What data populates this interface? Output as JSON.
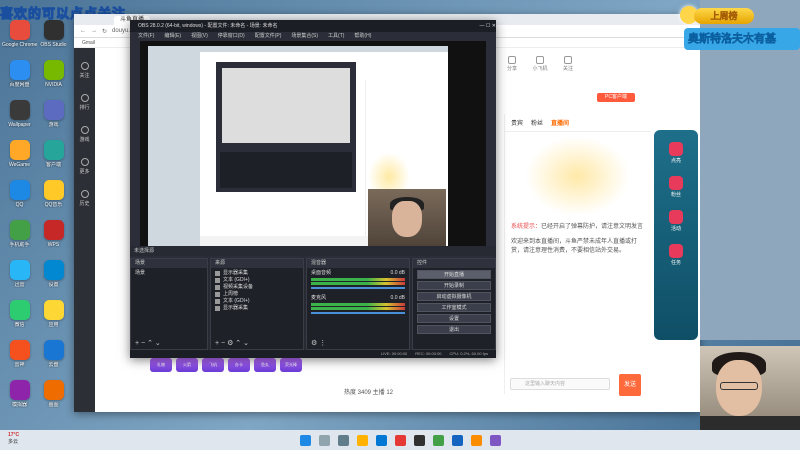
{
  "overlay": {
    "left_banner": "喜欢的可以点点关注",
    "right_badge": "上周榜",
    "right_scroll": "奥斯特洛夫木有基"
  },
  "desktop_icons": {
    "col1": [
      "Google Chrome",
      "百度网盘",
      "Wallpaper",
      "WeGame",
      "QQ",
      "手机助手",
      "迅雷",
      "微信",
      "雷神",
      "模拟器"
    ],
    "col2": [
      "OBS Studio",
      "NVIDIA",
      "游戏",
      "客户端",
      "QQ音乐",
      "WPS",
      "设置",
      "应用",
      "云盘",
      "画图"
    ]
  },
  "browser": {
    "tab_label": "斗鱼直播",
    "address": "douyu.com",
    "bookmark": "Gmail",
    "left_nav": [
      "关注",
      "排行",
      "游戏",
      "更多",
      "历史"
    ],
    "top_actions": [
      "分享",
      "小飞机",
      "关注"
    ],
    "pc_button": "PC客户端",
    "chat_tabs": [
      "贵宾",
      "粉丝",
      "直播间"
    ],
    "chat_messages": [
      {
        "prefix": "系统提示：",
        "text": "已经开启了弹幕防护，请注意文明发言"
      },
      {
        "prefix": "",
        "text": "欢迎来到本直播间，斗鱼严禁未成年人直播或打赏，请注意理性消费，不要相信站外交易。"
      }
    ],
    "right_rail": [
      "点亮",
      "粉丝",
      "活动",
      "任务"
    ],
    "bottom_stats": "热度 3409  主播 12",
    "chat_placeholder": "这里输入聊天内容",
    "send_label": "发送",
    "gifts": [
      "礼物",
      "火箭",
      "飞机",
      "办卡",
      "鱼丸",
      "荧光棒"
    ]
  },
  "obs": {
    "title": "OBS 28.0.2 (64-bit, windows) - 配置文件: 未命名 - 场景: 未命名",
    "menu": [
      "文件(F)",
      "编辑(E)",
      "视图(V)",
      "停靠窗口(D)",
      "配置文件(P)",
      "场景集合(S)",
      "工具(T)",
      "帮助(H)"
    ],
    "scene_bar_label": "未选择源",
    "docks": {
      "scenes": {
        "title": "场景",
        "items": [
          "场景"
        ]
      },
      "sources": {
        "title": "来源",
        "items": [
          "显示器采集",
          "文本 (GDI+)",
          "视频采集设备",
          "上周榜",
          "文本 (GDI+)",
          "显示器采集"
        ]
      },
      "mixer": {
        "title": "混音器",
        "channels": [
          {
            "name": "桌面音频",
            "db": "0.0 dB"
          },
          {
            "name": "麦克风",
            "db": "0.0 dB"
          }
        ]
      },
      "transitions": {
        "title": "转场"
      },
      "controls": {
        "title": "控件",
        "buttons": [
          "开始直播",
          "开始录制",
          "启动虚拟摄像机",
          "工作室模式",
          "设置",
          "退出"
        ]
      }
    },
    "status": {
      "live": "LIVE: 00:00:00",
      "rec": "REC: 00:00:00",
      "cpu": "CPU: 0.2%, 60.00 fps"
    }
  },
  "taskbar": {
    "temp": "17°C",
    "weather": "多云"
  }
}
